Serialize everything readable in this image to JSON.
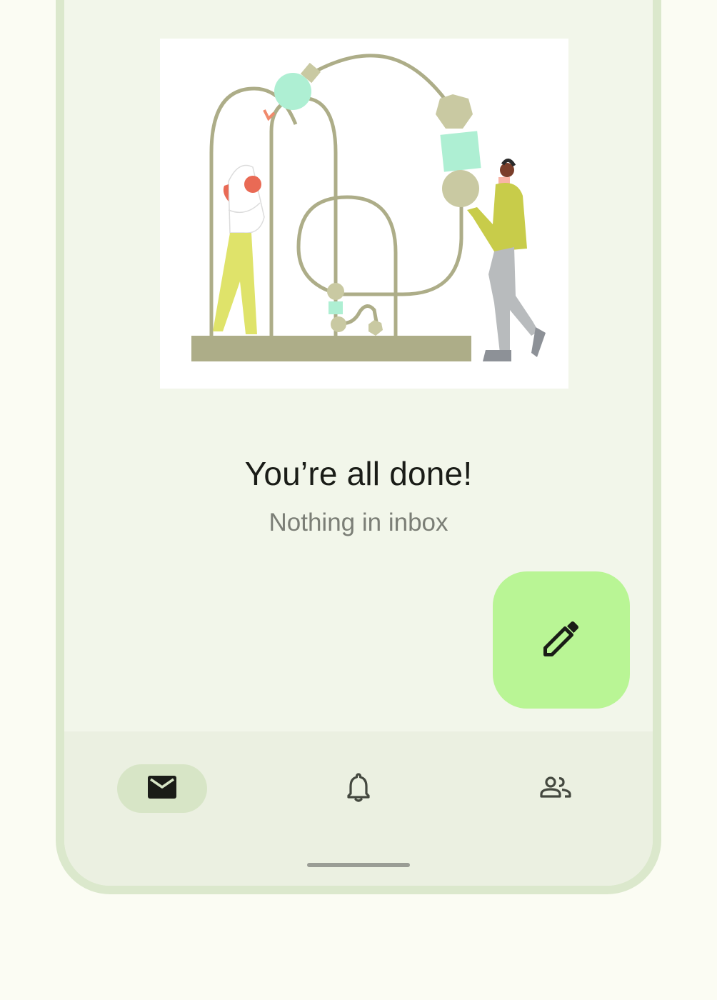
{
  "empty_state": {
    "title": "You’re all done!",
    "subtitle": "Nothing in inbox"
  },
  "fab": {
    "icon": "edit-pencil-icon",
    "color": "#b9f595"
  },
  "bottom_nav": {
    "items": [
      {
        "id": "inbox",
        "icon": "mail-icon",
        "active": true
      },
      {
        "id": "notifications",
        "icon": "bell-icon",
        "active": false
      },
      {
        "id": "contacts",
        "icon": "people-icon",
        "active": false
      }
    ],
    "active_indicator_color": "#d7e5c6"
  },
  "colors": {
    "frame": "#dbe8cc",
    "surface": "#f2f6ea",
    "nav_surface": "#ebf0e1",
    "background": "#fbfcf3"
  }
}
